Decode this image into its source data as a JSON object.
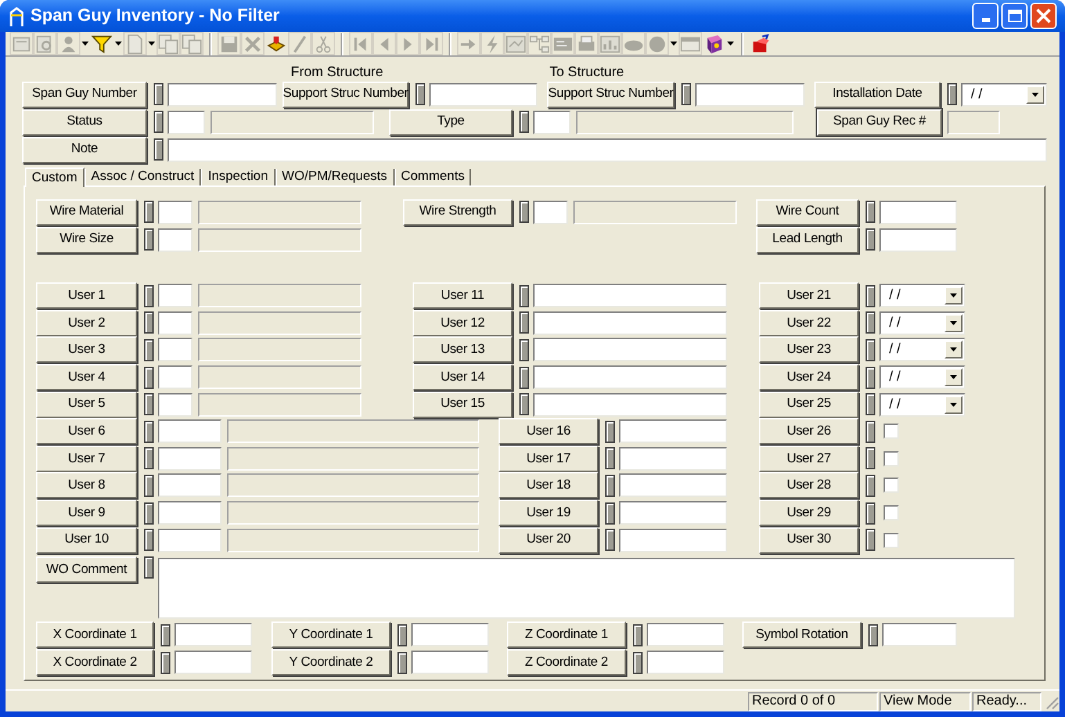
{
  "window": {
    "title": "Span Guy Inventory - No Filter"
  },
  "toolbar": [
    {
      "items": [
        {
          "kind": "form",
          "disabled": true,
          "dropdown": false
        },
        {
          "kind": "search",
          "disabled": true,
          "dropdown": false
        },
        {
          "kind": "user",
          "disabled": true,
          "dropdown": true
        },
        {
          "kind": "filter",
          "disabled": false,
          "dropdown": true
        },
        {
          "kind": "doc",
          "disabled": true,
          "dropdown": true
        },
        {
          "kind": "copy",
          "disabled": true,
          "dropdown": false
        },
        {
          "kind": "copy",
          "disabled": true,
          "dropdown": false
        }
      ]
    },
    {
      "items": [
        {
          "kind": "save",
          "disabled": true,
          "dropdown": false
        },
        {
          "kind": "delete",
          "disabled": true,
          "dropdown": false
        },
        {
          "kind": "wizard",
          "disabled": false,
          "dropdown": false
        },
        {
          "kind": "pencil",
          "disabled": true,
          "dropdown": false
        },
        {
          "kind": "scissors",
          "disabled": true,
          "dropdown": false
        }
      ]
    },
    {
      "items": [
        {
          "kind": "first",
          "disabled": true,
          "dropdown": false
        },
        {
          "kind": "prev",
          "disabled": true,
          "dropdown": false
        },
        {
          "kind": "next",
          "disabled": true,
          "dropdown": false
        },
        {
          "kind": "last",
          "disabled": true,
          "dropdown": false
        }
      ]
    },
    {
      "items": [
        {
          "kind": "arrow",
          "disabled": true,
          "dropdown": false
        },
        {
          "kind": "lightning",
          "disabled": true,
          "dropdown": false
        },
        {
          "kind": "map",
          "disabled": true,
          "dropdown": false
        },
        {
          "kind": "tree",
          "disabled": true,
          "dropdown": false
        },
        {
          "kind": "list",
          "disabled": true,
          "dropdown": false
        },
        {
          "kind": "printer",
          "disabled": true,
          "dropdown": false
        },
        {
          "kind": "chart",
          "disabled": true,
          "dropdown": false
        },
        {
          "kind": "cloud",
          "disabled": true,
          "dropdown": false
        },
        {
          "kind": "bubble",
          "disabled": true,
          "dropdown": true
        },
        {
          "kind": "window",
          "disabled": true,
          "dropdown": false
        },
        {
          "kind": "book",
          "disabled": false,
          "dropdown": true
        }
      ]
    },
    {
      "items": [
        {
          "kind": "exit",
          "disabled": false,
          "dropdown": false
        }
      ]
    }
  ],
  "header": {
    "span_guy_number": {
      "label": "Span Guy Number"
    },
    "from_structure": {
      "caption": "From Structure",
      "label": "Support Struc Number"
    },
    "to_structure": {
      "caption": "To Structure",
      "label": "Support Struc Number"
    },
    "installation_date": {
      "label": "Installation Date",
      "value": "/ /"
    },
    "status": {
      "label": "Status"
    },
    "type": {
      "label": "Type"
    },
    "span_guy_rec": {
      "label": "Span Guy Rec #"
    },
    "note": {
      "label": "Note"
    }
  },
  "tabs": [
    {
      "label": "Custom",
      "selected": true
    },
    {
      "label": "Assoc / Construct",
      "selected": false
    },
    {
      "label": "Inspection",
      "selected": false
    },
    {
      "label": "WO/PM/Requests",
      "selected": false
    },
    {
      "label": "Comments",
      "selected": false
    }
  ],
  "custom": {
    "wire_material": {
      "label": "Wire Material"
    },
    "wire_size": {
      "label": "Wire Size"
    },
    "wire_strength": {
      "label": "Wire Strength"
    },
    "wire_count": {
      "label": "Wire Count"
    },
    "lead_length": {
      "label": "Lead Length"
    },
    "user_fields": [
      {
        "label": "User 1",
        "kind": "short"
      },
      {
        "label": "User 2",
        "kind": "short"
      },
      {
        "label": "User 3",
        "kind": "short"
      },
      {
        "label": "User 4",
        "kind": "short"
      },
      {
        "label": "User 5",
        "kind": "short"
      },
      {
        "label": "User 6",
        "kind": "wide"
      },
      {
        "label": "User 7",
        "kind": "wide"
      },
      {
        "label": "User 8",
        "kind": "wide"
      },
      {
        "label": "User 9",
        "kind": "wide"
      },
      {
        "label": "User 10",
        "kind": "wide"
      },
      {
        "label": "User 11",
        "kind": "text"
      },
      {
        "label": "User 12",
        "kind": "text"
      },
      {
        "label": "User 13",
        "kind": "text"
      },
      {
        "label": "User 14",
        "kind": "text"
      },
      {
        "label": "User 15",
        "kind": "text"
      },
      {
        "label": "User 16",
        "kind": "text_short"
      },
      {
        "label": "User 17",
        "kind": "text_short"
      },
      {
        "label": "User 18",
        "kind": "text_short"
      },
      {
        "label": "User 19",
        "kind": "text_short"
      },
      {
        "label": "User 20",
        "kind": "text_short"
      },
      {
        "label": "User 21",
        "kind": "date",
        "value": "/ /"
      },
      {
        "label": "User 22",
        "kind": "date",
        "value": "/ /"
      },
      {
        "label": "User 23",
        "kind": "date",
        "value": "/ /"
      },
      {
        "label": "User 24",
        "kind": "date",
        "value": "/ /"
      },
      {
        "label": "User 25",
        "kind": "date",
        "value": "/ /"
      },
      {
        "label": "User 26",
        "kind": "check",
        "checked": false
      },
      {
        "label": "User 27",
        "kind": "check",
        "checked": false
      },
      {
        "label": "User 28",
        "kind": "check",
        "checked": false
      },
      {
        "label": "User 29",
        "kind": "check",
        "checked": false
      },
      {
        "label": "User 30",
        "kind": "check",
        "checked": false
      }
    ],
    "wo_comment": {
      "label": "WO Comment"
    },
    "coordinates": [
      {
        "label": "X Coordinate 1"
      },
      {
        "label": "Y Coordinate 1"
      },
      {
        "label": "Z Coordinate 1"
      },
      {
        "label": "Symbol Rotation"
      },
      {
        "label": "X Coordinate 2"
      },
      {
        "label": "Y Coordinate 2"
      },
      {
        "label": "Z Coordinate 2"
      }
    ]
  },
  "status_bar": [
    "Record 0 of 0",
    "View Mode",
    "Ready..."
  ]
}
